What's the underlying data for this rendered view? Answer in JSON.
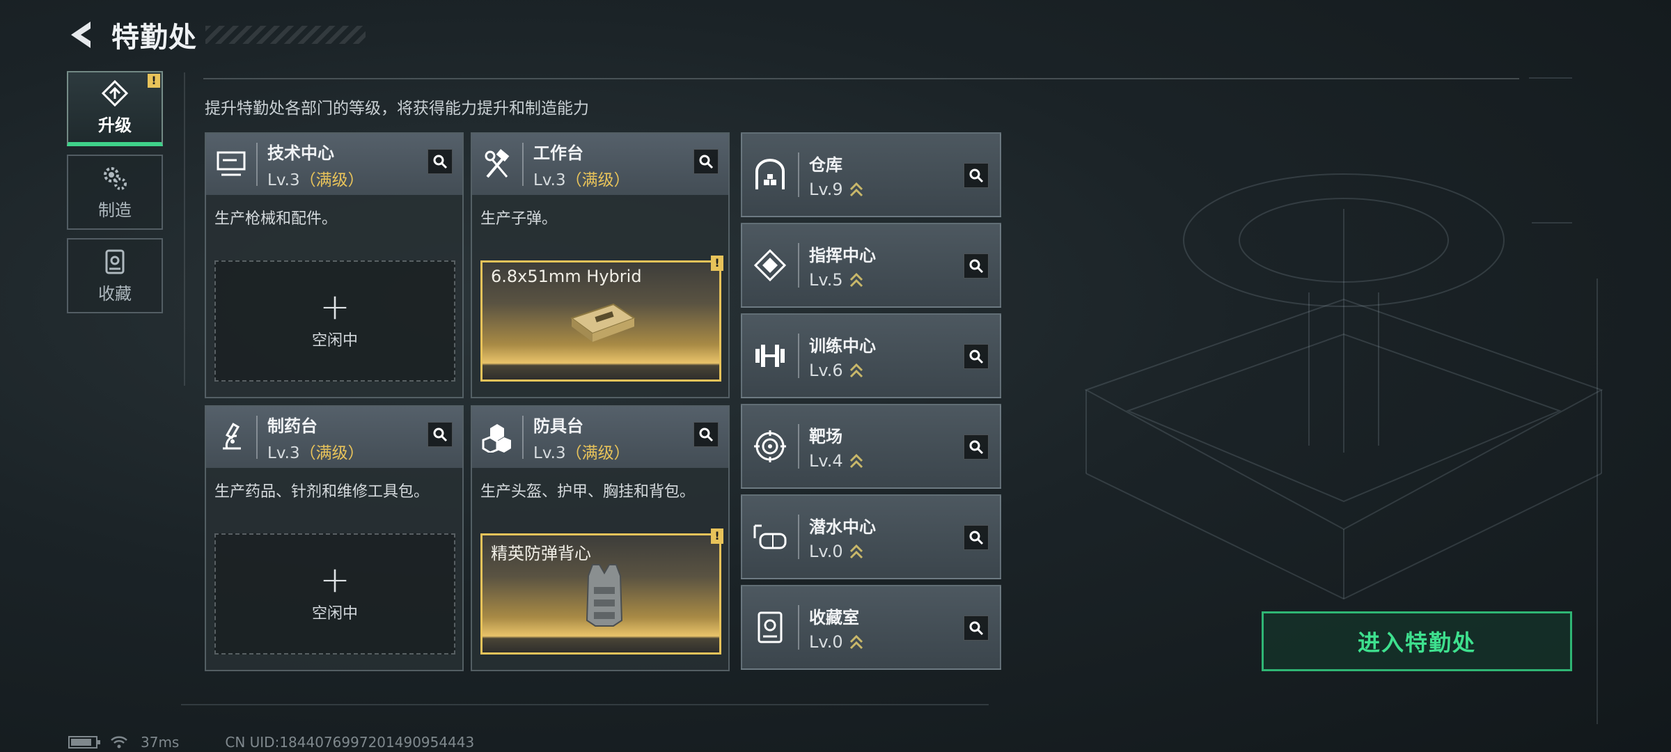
{
  "header": {
    "title": "特勤处"
  },
  "tabs": [
    {
      "label": "升级",
      "active": true,
      "alert": "!"
    },
    {
      "label": "制造",
      "active": false
    },
    {
      "label": "收藏",
      "active": false
    }
  ],
  "description": "提升特勤处各部门的等级，将获得能力提升和制造能力",
  "departments": [
    {
      "name": "技术中心",
      "level": "Lv.3",
      "max_label": "（满级）",
      "desc": "生产枪械和配件。",
      "slot": {
        "type": "idle",
        "plus": "+",
        "text": "空闲中"
      }
    },
    {
      "name": "工作台",
      "level": "Lv.3",
      "max_label": "（满级）",
      "desc": "生产子弹。",
      "slot": {
        "type": "item",
        "text": "6.8x51mm Hybrid",
        "alert": "!"
      }
    },
    {
      "name": "制药台",
      "level": "Lv.3",
      "max_label": "（满级）",
      "desc": "生产药品、针剂和维修工具包。",
      "slot": {
        "type": "idle",
        "plus": "+",
        "text": "空闲中"
      }
    },
    {
      "name": "防具台",
      "level": "Lv.3",
      "max_label": "（满级）",
      "desc": "生产头盔、护甲、胸挂和背包。",
      "slot": {
        "type": "item",
        "text": "精英防弹背心",
        "alert": "!"
      }
    }
  ],
  "facilities": [
    {
      "name": "仓库",
      "level": "Lv.9"
    },
    {
      "name": "指挥中心",
      "level": "Lv.5"
    },
    {
      "name": "训练中心",
      "level": "Lv.6"
    },
    {
      "name": "靶场",
      "level": "Lv.4"
    },
    {
      "name": "潜水中心",
      "level": "Lv.0"
    },
    {
      "name": "收藏室",
      "level": "Lv.0"
    }
  ],
  "enter_button": "进入特勤处",
  "status_bar": {
    "ping": "37ms",
    "uid": "CN UID:1844076997201490954443",
    "battery_level": 0.85
  },
  "colors": {
    "accent_green": "#3ee08e",
    "gold": "#e8c35a",
    "upgrade_chevron": "#c9b86a"
  }
}
